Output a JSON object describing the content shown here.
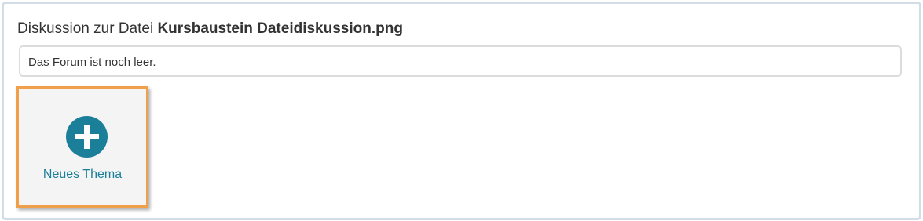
{
  "forum": {
    "heading_prefix": "Diskussion zur Datei ",
    "heading_filename": "Kursbaustein Dateidiskussion.png",
    "empty_message": "Das Forum ist noch leer.",
    "new_topic_label": "Neues Thema",
    "new_topic_icon": "plus-circle-icon"
  },
  "colors": {
    "accent": "#1b7f99",
    "highlight": "#f0a04b",
    "frame_border": "#d3dde8"
  }
}
